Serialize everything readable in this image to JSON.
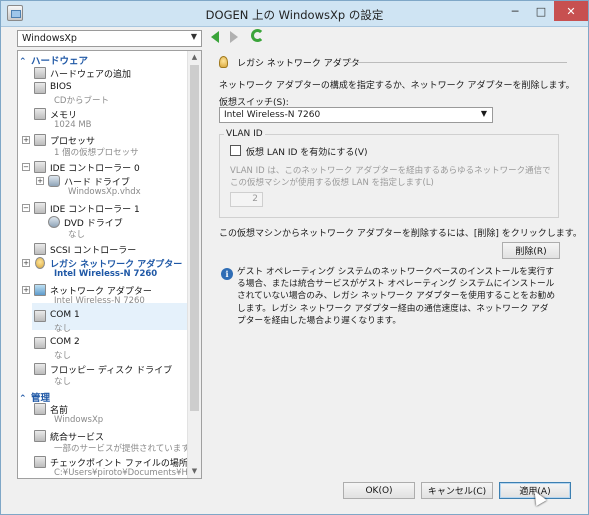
{
  "window": {
    "title": "DOGEN 上の WindowsXp の設定",
    "min": "─",
    "max": "□",
    "close": "✕"
  },
  "vm_selector": {
    "value": "WindowsXp"
  },
  "tree": {
    "hardware_header": "ハードウェア",
    "items": [
      {
        "label": "ハードウェアの追加",
        "sub": ""
      },
      {
        "label": "BIOS",
        "sub": "CDからブート"
      },
      {
        "label": "メモリ",
        "sub": "1024 MB"
      },
      {
        "label": "プロセッサ",
        "sub": "1 個の仮想プロセッサ"
      },
      {
        "label": "IDE コントローラー 0",
        "sub": ""
      },
      {
        "label": "ハード ドライブ",
        "sub": "WindowsXp.vhdx"
      },
      {
        "label": "IDE コントローラー 1",
        "sub": ""
      },
      {
        "label": "DVD ドライブ",
        "sub": "なし"
      },
      {
        "label": "SCSI コントローラー",
        "sub": ""
      },
      {
        "label": "レガシ ネットワーク アダプター",
        "sub": "Intel Wireless-N 7260"
      },
      {
        "label": "ネットワーク アダプター",
        "sub": "Intel Wireless-N 7260"
      },
      {
        "label": "COM 1",
        "sub": "なし"
      },
      {
        "label": "COM 2",
        "sub": "なし"
      },
      {
        "label": "フロッピー ディスク ドライブ",
        "sub": "なし"
      }
    ],
    "management_header": "管理",
    "mgmt_items": [
      {
        "label": "名前",
        "sub": "WindowsXp"
      },
      {
        "label": "統合サービス",
        "sub": "一部のサービスが提供されています"
      },
      {
        "label": "チェックポイント ファイルの場所",
        "sub": "C:¥Users¥piroto¥Documents¥H"
      }
    ]
  },
  "panel": {
    "header": "レガシ ネットワーク アダプター",
    "description": "ネットワーク アダプターの構成を指定するか、ネットワーク アダプターを削除します。",
    "vswitch_label": "仮想スイッチ(S):",
    "vswitch_value": "Intel Wireless-N 7260",
    "vlan_legend": "VLAN ID",
    "vlan_checkbox": "仮想 LAN ID を有効にする(V)",
    "vlan_note": "VLAN ID は、このネットワーク アダプターを経由するあらゆるネットワーク通信でこの仮想マシンが使用する仮想 LAN を指定します(L)",
    "vlan_value": "2",
    "remove_note": "この仮想マシンからネットワーク アダプターを削除するには、[削除] をクリックします。",
    "remove_button": "削除(R)",
    "info_text": "ゲスト オペレーティング システムのネットワークベースのインストールを実行する場合、または統合サービスがゲスト オペレーティング システムにインストールされていない場合のみ、レガシ ネットワーク アダプターを使用することをお勧めします。レガシ ネットワーク アダプター経由の通信速度は、ネットワーク アダプターを経由した場合より遅くなります。"
  },
  "footer": {
    "ok": "OK(O)",
    "cancel": "キャンセル(C)",
    "apply": "適用(A)"
  }
}
